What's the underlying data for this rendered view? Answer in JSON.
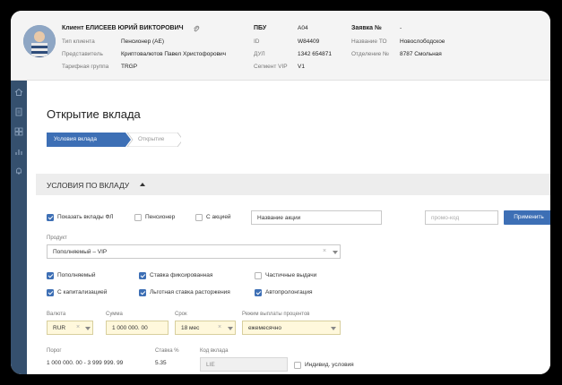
{
  "client": {
    "name": "Клиент ЕЛИСЕЕВ ЮРИЙ ВИКТОРОВИЧ",
    "type_label": "Тип клиента",
    "type_value": "Пенсионер (АЕ)",
    "rep_label": "Представитель",
    "rep_value": "Криптовалютов Павел Христофорович",
    "tariff_label": "Тарифная группа",
    "tariff_value": "TRGP"
  },
  "meta": {
    "pbu_label": "ПБУ",
    "pbu_value": "А04",
    "id_label": "ID",
    "id_value": "W84409",
    "dul_label": "ДУЛ",
    "dul_value": "1342 654871",
    "segment_label": "Сегмент VIP",
    "segment_value": "V1"
  },
  "request": {
    "label": "Заявка №",
    "value": "-",
    "to_label": "Название ТО",
    "to_value": "Новослободское",
    "branch_label": "Отделение №",
    "branch_value": "8787 Смольная"
  },
  "page": {
    "title": "Открытие вклада",
    "steps": [
      "Условия вклада",
      "Открытие"
    ],
    "active_step": 0
  },
  "section": {
    "title": "УСЛОВИЯ ПО ВКЛАДУ"
  },
  "filters": {
    "show_fl": {
      "label": "Показать вклады ФЛ",
      "checked": true
    },
    "pensioner": {
      "label": "Пенсионер",
      "checked": false
    },
    "promo": {
      "label": "С акцией",
      "checked": false
    },
    "action_name_placeholder": "Название акции",
    "promo_code_placeholder": "промо-код",
    "apply_label": "Применить"
  },
  "product": {
    "label": "Продукт",
    "value": "Пополняемый – VIP"
  },
  "options": [
    {
      "label": "Пополняемый",
      "checked": true
    },
    {
      "label": "Ставка фиксированная",
      "checked": true
    },
    {
      "label": "Частичные выдачи",
      "checked": false
    },
    {
      "label": "С капитализацией",
      "checked": true
    },
    {
      "label": "Льготная ставка расторжения",
      "checked": true
    },
    {
      "label": "Автопролонгация",
      "checked": true
    }
  ],
  "params": {
    "currency_label": "Валюта",
    "currency_value": "RUR",
    "amount_label": "Сумма",
    "amount_value": "1 000 000. 00",
    "term_label": "Срок",
    "term_value": "18 мес",
    "payout_label": "Режим выплаты процентов",
    "payout_value": "ежемесячно"
  },
  "info": {
    "threshold_label": "Порог",
    "threshold_value": "1 000 000. 00 - 3 999 999. 99",
    "rate_label": "Ставка %",
    "rate_value": "5.35",
    "code_label": "Код вклада",
    "code_value": "LIE",
    "individual_label": "Индивид. условия",
    "individual_checked": false
  },
  "colors": {
    "accent": "#3d6fb5",
    "sidebar": "#35506e",
    "header_bg": "#f4f4f4",
    "field_highlight": "#fff8dc"
  }
}
